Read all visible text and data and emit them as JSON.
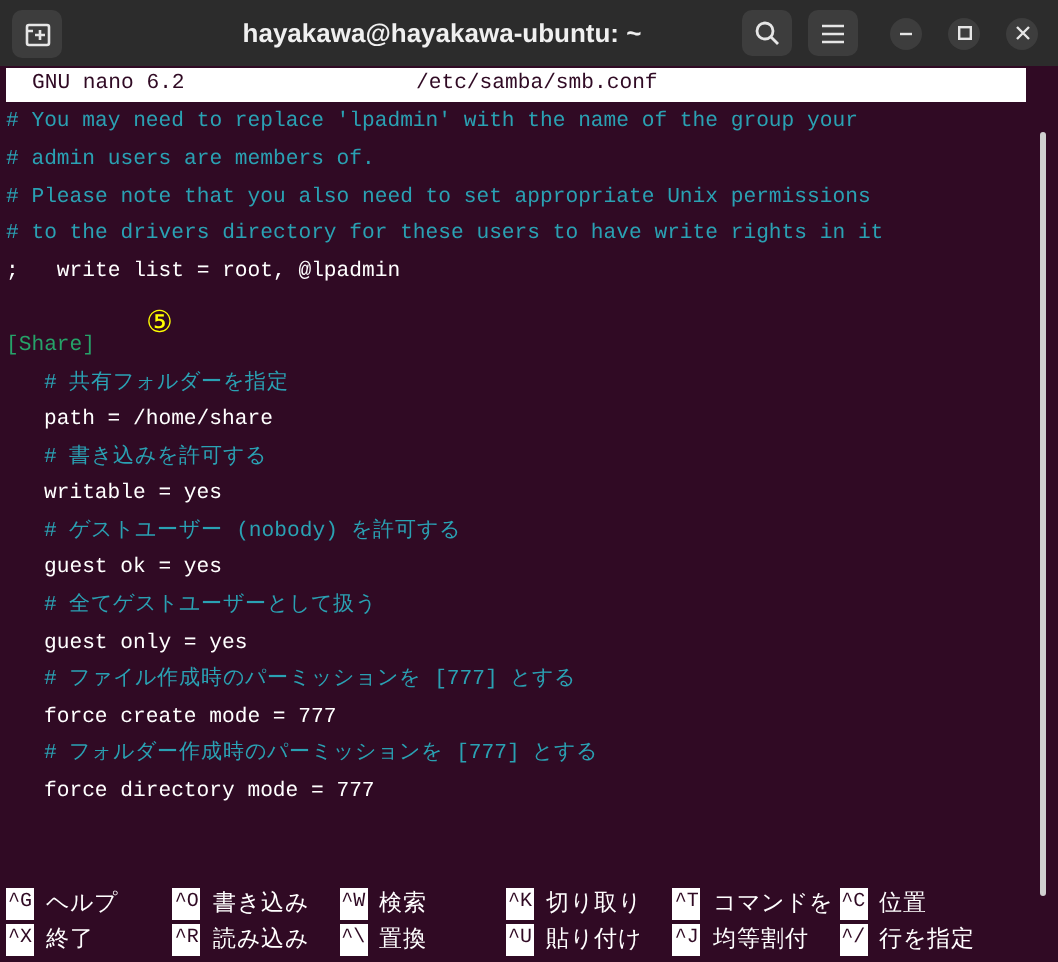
{
  "window": {
    "title": "hayakawa@hayakawa-ubuntu: ~"
  },
  "nano_header": {
    "version": "GNU nano 6.2",
    "file": "/etc/samba/smb.conf"
  },
  "lines": [
    {
      "kind": "comment",
      "text": "# You may need to replace 'lpadmin' with the name of the group your"
    },
    {
      "kind": "comment",
      "text": "# admin users are members of."
    },
    {
      "kind": "comment",
      "text": "# Please note that you also need to set appropriate Unix permissions"
    },
    {
      "kind": "comment",
      "text": "# to the drivers directory for these users to have write rights in it"
    },
    {
      "kind": "code",
      "text": ";   write list = root, @lpadmin"
    },
    {
      "kind": "blank",
      "annotation": "⑤"
    },
    {
      "kind": "section",
      "text": "[Share]",
      "children": [
        {
          "kind": "comment",
          "text": "# 共有フォルダーを指定"
        },
        {
          "kind": "code",
          "text": "path = /home/share"
        },
        {
          "kind": "comment",
          "text": "# 書き込みを許可する"
        },
        {
          "kind": "code",
          "text": "writable = yes"
        },
        {
          "kind": "comment",
          "text": "# ゲストユーザー (nobody) を許可する"
        },
        {
          "kind": "code",
          "text": "guest ok = yes"
        },
        {
          "kind": "comment",
          "text": "# 全てゲストユーザーとして扱う"
        },
        {
          "kind": "code",
          "text": "guest only = yes"
        },
        {
          "kind": "comment",
          "text": "# ファイル作成時のパーミッションを [777] とする"
        },
        {
          "kind": "code",
          "text": "force create mode = 777"
        },
        {
          "kind": "comment",
          "text": "# フォルダー作成時のパーミッションを [777] とする"
        },
        {
          "kind": "code",
          "text": "force directory mode = 777"
        }
      ]
    }
  ],
  "shortcuts": [
    {
      "key": "^G",
      "label": "ヘルプ"
    },
    {
      "key": "^O",
      "label": "書き込み"
    },
    {
      "key": "^W",
      "label": "検索"
    },
    {
      "key": "^K",
      "label": "切り取り"
    },
    {
      "key": "^T",
      "label": "コマンドを"
    },
    {
      "key": "^C",
      "label": "位置"
    },
    {
      "key": "^X",
      "label": "終了"
    },
    {
      "key": "^R",
      "label": "読み込み"
    },
    {
      "key": "^\\",
      "label": "置換"
    },
    {
      "key": "^U",
      "label": "貼り付け"
    },
    {
      "key": "^J",
      "label": "均等割付"
    },
    {
      "key": "^/",
      "label": "行を指定"
    }
  ]
}
